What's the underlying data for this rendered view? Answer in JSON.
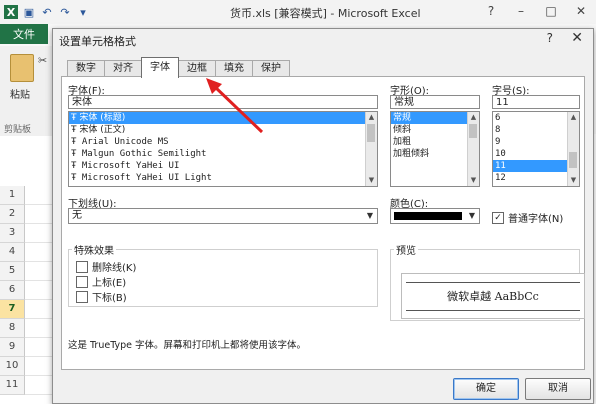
{
  "app": {
    "title": "货币.xls  [兼容模式] - Microsoft Excel",
    "file_tab": "文件",
    "paste_label": "粘贴",
    "clipboard_label": "剪贴板",
    "row_numbers": [
      "1",
      "2",
      "3",
      "4",
      "5",
      "6",
      "7",
      "8",
      "9",
      "10",
      "11"
    ],
    "active_row": "7",
    "window_controls": {
      "help": "?",
      "minimize": "–",
      "maximize": "□",
      "close": "✕"
    }
  },
  "dialog": {
    "title": "设置单元格格式",
    "help": "?",
    "close": "✕",
    "tabs": [
      {
        "label": "数字",
        "selected": false
      },
      {
        "label": "对齐",
        "selected": false
      },
      {
        "label": "字体",
        "selected": true
      },
      {
        "label": "边框",
        "selected": false
      },
      {
        "label": "填充",
        "selected": false
      },
      {
        "label": "保护",
        "selected": false
      }
    ],
    "font": {
      "label": "字体(F):",
      "value": "宋体",
      "items": [
        {
          "text": "宋体 (标题)",
          "selected": true,
          "cjk": true
        },
        {
          "text": "宋体 (正文)",
          "selected": false,
          "cjk": true
        },
        {
          "text": "Arial Unicode MS",
          "selected": false,
          "cjk": false
        },
        {
          "text": "Malgun Gothic Semilight",
          "selected": false,
          "cjk": false
        },
        {
          "text": "Microsoft YaHei UI",
          "selected": false,
          "cjk": false
        },
        {
          "text": "Microsoft YaHei UI Light",
          "selected": false,
          "cjk": false
        }
      ]
    },
    "style": {
      "label": "字形(O):",
      "value": "常规",
      "items": [
        {
          "text": "常规",
          "selected": true
        },
        {
          "text": "倾斜",
          "selected": false
        },
        {
          "text": "加粗",
          "selected": false
        },
        {
          "text": "加粗倾斜",
          "selected": false
        }
      ]
    },
    "size": {
      "label": "字号(S):",
      "value": "11",
      "items": [
        {
          "text": "6",
          "selected": false
        },
        {
          "text": "8",
          "selected": false
        },
        {
          "text": "9",
          "selected": false
        },
        {
          "text": "10",
          "selected": false
        },
        {
          "text": "11",
          "selected": true
        },
        {
          "text": "12",
          "selected": false
        }
      ]
    },
    "underline": {
      "label": "下划线(U):",
      "value": "无"
    },
    "color": {
      "label": "颜色(C):",
      "swatch": "#000000"
    },
    "normal_font": {
      "label": "普通字体(N)",
      "checked": true
    },
    "effects": {
      "label": "特殊效果",
      "items": [
        {
          "text": "删除线(K)",
          "checked": false
        },
        {
          "text": "上标(E)",
          "checked": false
        },
        {
          "text": "下标(B)",
          "checked": false
        }
      ]
    },
    "preview": {
      "label": "预览",
      "sample": "微软卓越  AaBbCc"
    },
    "info": "这是 TrueType 字体。屏幕和打印机上都将使用该字体。",
    "ok_label": "确定",
    "cancel_label": "取消"
  },
  "colors": {
    "accent": "#217346",
    "selection": "#3399ff",
    "arrow": "#e02020"
  }
}
